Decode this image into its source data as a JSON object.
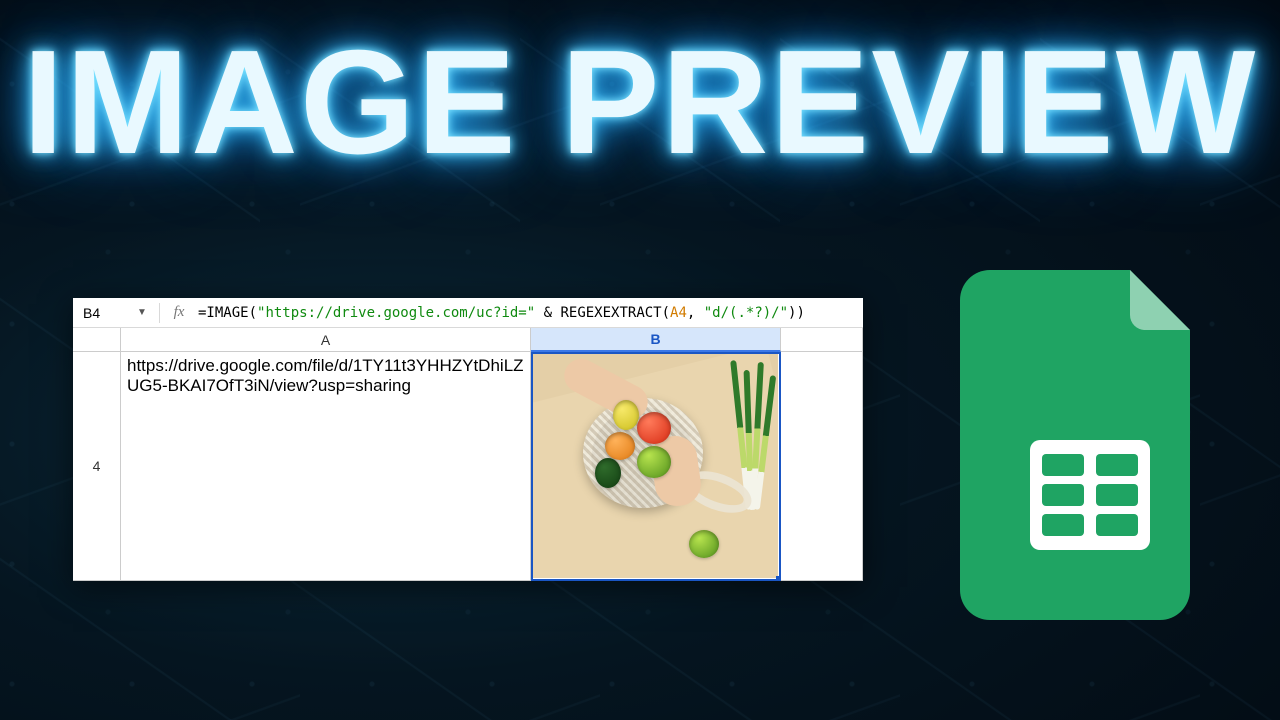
{
  "title": "IMAGE PREVIEW",
  "sheet": {
    "name_box": "B4",
    "fx_label": "fx",
    "formula": {
      "p1": "=IMAGE(",
      "str1": "\"https://drive.google.com/uc?id=\"",
      "p2": " & REGEXEXTRACT(",
      "ref": "A4",
      "p3": ", ",
      "str2": "\"d/(.*?)/\"",
      "p4": "))"
    },
    "columns": {
      "A": "A",
      "B": "B"
    },
    "row_label": "4",
    "a4_value": "https://drive.google.com/file/d/1TY11t3YHHZYtDhiLZUG5-BKAI7OfT3iN/view?usp=sharing"
  },
  "logo": {
    "name": "google-sheets"
  }
}
